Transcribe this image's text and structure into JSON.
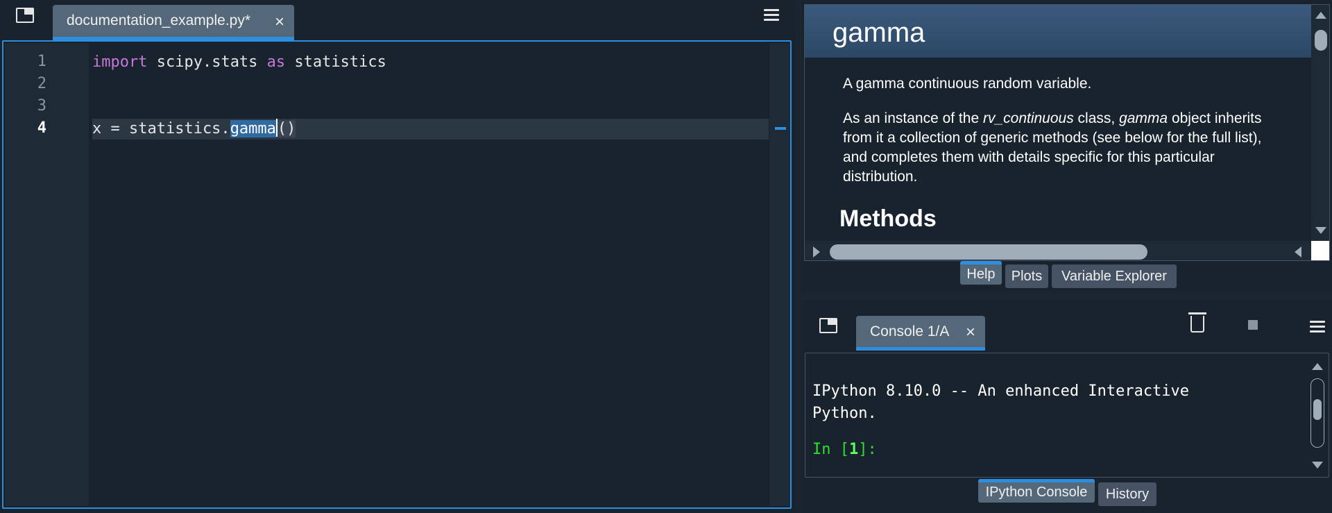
{
  "editor": {
    "tab_label": "documentation_example.py*",
    "tab_close": "×",
    "line_numbers": [
      "1",
      "2",
      "3",
      "4"
    ],
    "lines": {
      "l1_kw1": "import",
      "l1_mid": " scipy.stats ",
      "l1_kw2": "as",
      "l1_end": " statistics",
      "l4_pre": "x = statistics.",
      "l4_sel": "gamma",
      "l4_open": "(",
      "l4_close": ")"
    }
  },
  "help": {
    "title": "gamma",
    "para1": "A gamma continuous random variable.",
    "para2_pre": "As an instance of the ",
    "para2_em1": "rv_continuous",
    "para2_mid": " class, ",
    "para2_em2": "gamma",
    "para2_post": " object inherits from it a collection of generic methods (see below for the full list), and completes them with details specific for this particular distribution.",
    "methods_heading": "Methods",
    "tabs": [
      "Help",
      "Plots",
      "Variable Explorer"
    ]
  },
  "console": {
    "tab_label": "Console 1/A",
    "tab_close": "×",
    "banner_line1": "IPython 8.10.0 -- An enhanced Interactive",
    "banner_line2": "Python.",
    "prompt_pre": "In [",
    "prompt_num": "1",
    "prompt_post": "]:",
    "tabs": [
      "IPython Console",
      "History"
    ]
  },
  "colors": {
    "accent": "#2d8ee0",
    "keyword": "#c678dd",
    "prompt": "#2ee02e"
  },
  "icons": {
    "editor_undock": "undock-icon",
    "editor_menu": "hamburger-icon",
    "console_undock": "undock-icon",
    "console_clear": "trash-icon",
    "console_stop": "stop-icon",
    "console_menu": "hamburger-icon"
  }
}
